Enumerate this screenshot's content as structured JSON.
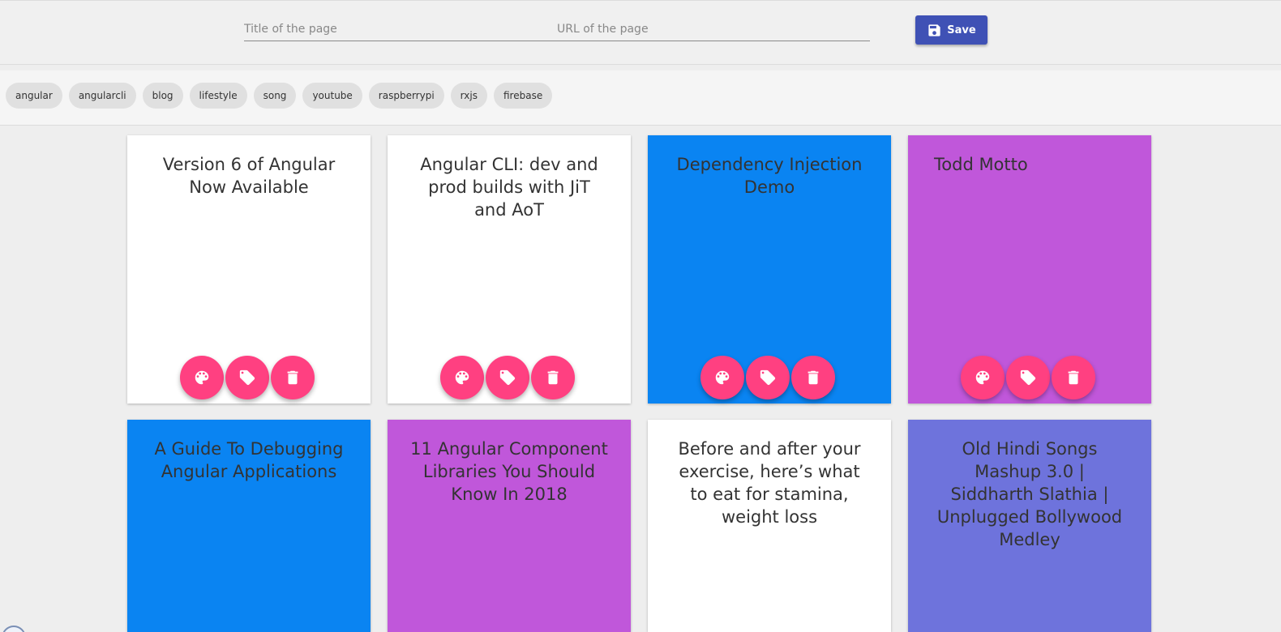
{
  "form": {
    "title_placeholder": "Title of the page",
    "url_placeholder": "URL of the page",
    "save_label": "Save"
  },
  "tags": [
    "angular",
    "angularcli",
    "blog",
    "lifestyle",
    "song",
    "youtube",
    "raspberrypi",
    "rxjs",
    "firebase"
  ],
  "cards": [
    {
      "title": "Version 6 of Angular Now Available",
      "color": "#ffffff"
    },
    {
      "title": "Angular CLI: dev and prod builds with JiT and AoT",
      "color": "#ffffff"
    },
    {
      "title": "Dependency Injection Demo",
      "color": "#0a84f2"
    },
    {
      "title": "Todd Motto",
      "color": "#c057da"
    },
    {
      "title": "A Guide To Debugging Angular Applications",
      "color": "#0a84f2"
    },
    {
      "title": "11 Angular Component Libraries You Should Know In 2018",
      "color": "#c057da"
    },
    {
      "title": "Before and after your exercise, here’s what to eat for stamina, weight loss",
      "color": "#ffffff"
    },
    {
      "title": "Old Hindi Songs Mashup 3.0 | Siddharth Slathia | Unplugged Bollywood Medley",
      "color": "#6e73dc"
    }
  ],
  "card_actions": [
    "palette-icon",
    "tag-icon",
    "delete-icon"
  ],
  "colors": {
    "accent": "#ff4081",
    "primary": "#3f51b5"
  }
}
